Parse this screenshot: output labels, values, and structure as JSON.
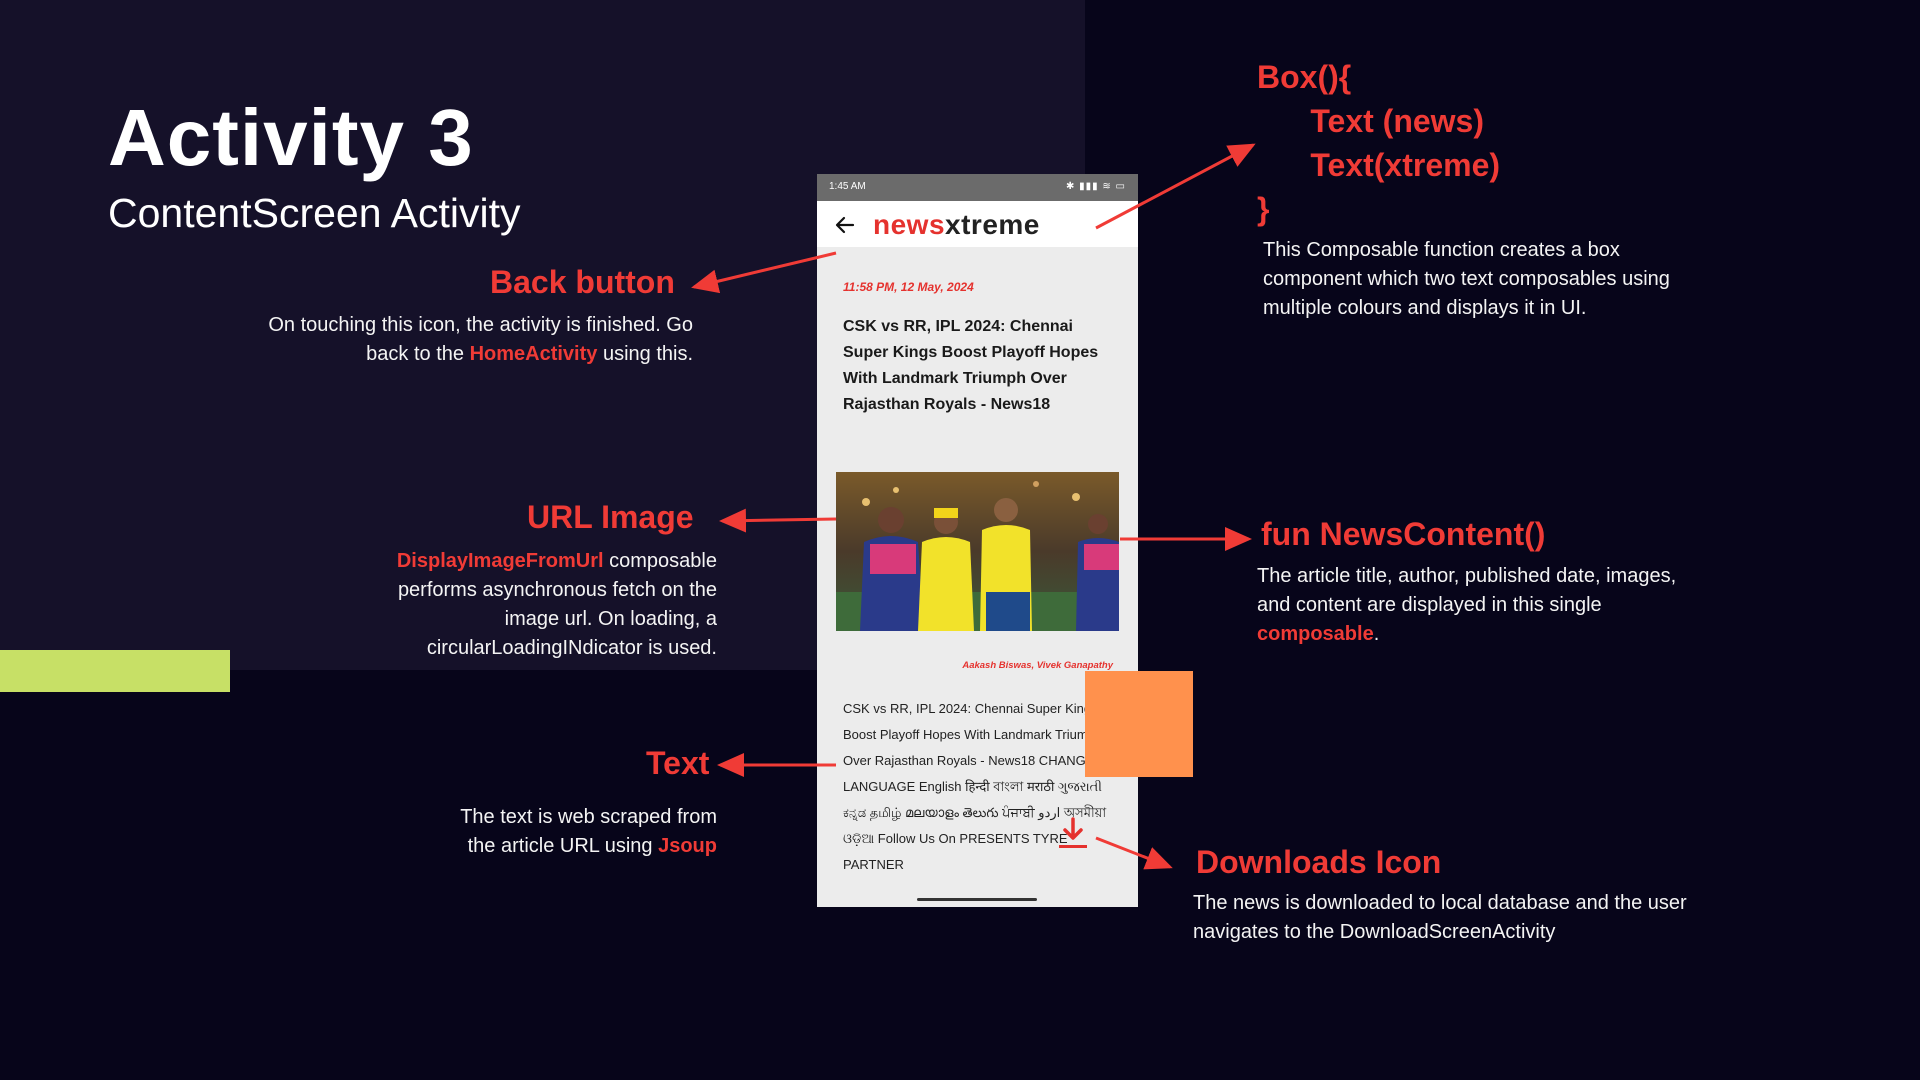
{
  "slide": {
    "title": "Activity 3",
    "subtitle": "ContentScreen Activity"
  },
  "annotations": {
    "back_button": {
      "heading": "Back button",
      "desc_1": "On touching this icon, the activity is finished. Go",
      "desc_2a": "back to the ",
      "desc_2_hl": "HomeActivity",
      "desc_2b": " using this."
    },
    "url_image": {
      "heading": "URL Image",
      "desc_hl": "DisplayImageFromUrl",
      "desc_1b": " composable",
      "desc_2": "performs  asynchronous fetch on the",
      "desc_3": "image url. On loading, a",
      "desc_4": "circularLoadingINdicator is used."
    },
    "text": {
      "heading": "Text",
      "desc_1": "The text is web scraped from",
      "desc_2a": "the article URL using ",
      "desc_2_hl": "Jsoup"
    },
    "box": {
      "code_1": "Box(){",
      "code_2": "      Text (news)",
      "code_3": "      Text(xtreme)",
      "code_4": "}",
      "desc_1": "This  Composable function creates a box",
      "desc_2": "component which two text composables using",
      "desc_3": "multiple colours and displays it in UI."
    },
    "news_content": {
      "heading": "fun  NewsContent()",
      "desc_1": "The article title,  author,  published date, images,",
      "desc_2": "and content are displayed in this single",
      "desc_3_hl": "composable",
      "desc_3b": "."
    },
    "downloads": {
      "heading": "Downloads Icon",
      "desc_1": "The news is downloaded to local database and the user",
      "desc_2": "navigates to the DownloadScreenActivity"
    }
  },
  "phone": {
    "status_time": "1:45 AM",
    "status_icons": "✱ ▮▮▮ ≋ ▭",
    "logo_news": "news",
    "logo_xtreme": "xtreme",
    "date": "11:58 PM, 12 May, 2024",
    "headline": "CSK vs RR, IPL 2024: Chennai Super Kings Boost Playoff Hopes With Landmark Triumph Over Rajasthan Royals - News18",
    "author": "Aakash Biswas, Vivek Ganapathy",
    "body": "CSK vs RR, IPL 2024: Chennai Super Kings Boost Playoff Hopes With Landmark Triumph Over Rajasthan Royals - News18 CHANGE LANGUAGE English हिन्दी বাংলা मराठी ગુજરાતી ಕನ್ನಡ தமிழ் മലയാളം తెలుగు ਪੰਜਾਬੀ اردو অসমীয়া ଓଡ଼ିଆ Follow Us On PRESENTS TYRE PARTNER"
  },
  "colors": {
    "accent_red": "#f03b36",
    "background": "#07051a",
    "panel": "#151129",
    "lime": "#c7e066",
    "orange": "#ff914d"
  }
}
